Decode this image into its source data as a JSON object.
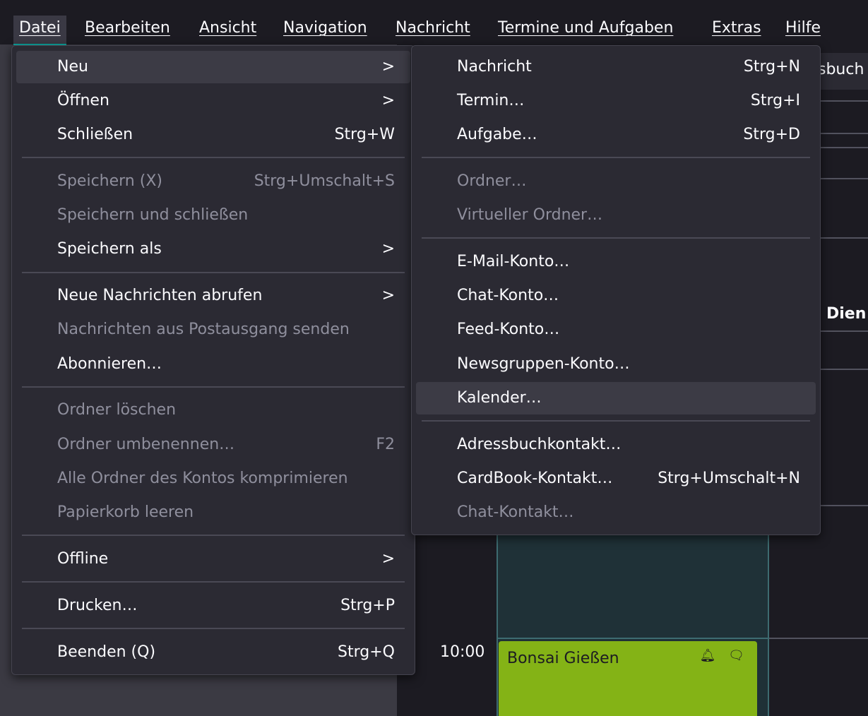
{
  "menubar": {
    "items": [
      {
        "label": "Datei"
      },
      {
        "label": "Bearbeiten"
      },
      {
        "label": "Ansicht"
      },
      {
        "label": "Navigation"
      },
      {
        "label": "Nachricht"
      },
      {
        "label": "Termine und Aufgaben"
      },
      {
        "label": "Extras"
      },
      {
        "label": "Hilfe"
      }
    ]
  },
  "datei_menu": {
    "items": [
      {
        "label": "Neu",
        "accel": "",
        "submenu": true
      },
      {
        "label": "Öffnen",
        "accel": "",
        "submenu": true
      },
      {
        "label": "Schließen",
        "accel": "Strg+W"
      },
      {
        "label": "Speichern (X)",
        "accel": "Strg+Umschalt+S"
      },
      {
        "label": "Speichern und schließen",
        "accel": ""
      },
      {
        "label": "Speichern als",
        "accel": "",
        "submenu": true
      },
      {
        "label": "Neue Nachrichten abrufen",
        "accel": "",
        "submenu": true
      },
      {
        "label": "Nachrichten aus Postausgang senden",
        "accel": ""
      },
      {
        "label": "Abonnieren…",
        "accel": ""
      },
      {
        "label": "Ordner löschen",
        "accel": ""
      },
      {
        "label": "Ordner umbenennen…",
        "accel": "F2"
      },
      {
        "label": "Alle Ordner des Kontos komprimieren",
        "accel": ""
      },
      {
        "label": "Papierkorb leeren",
        "accel": ""
      },
      {
        "label": "Offline",
        "accel": "",
        "submenu": true
      },
      {
        "label": "Drucken…",
        "accel": "Strg+P"
      },
      {
        "label": "Beenden (Q)",
        "accel": "Strg+Q"
      }
    ],
    "arrow": ">"
  },
  "neu_menu": {
    "items": [
      {
        "label": "Nachricht",
        "accel": "Strg+N"
      },
      {
        "label": "Termin…",
        "accel": "Strg+I"
      },
      {
        "label": "Aufgabe…",
        "accel": "Strg+D"
      },
      {
        "label": "Ordner…",
        "accel": ""
      },
      {
        "label": "Virtueller Ordner…",
        "accel": ""
      },
      {
        "label": "E-Mail-Konto…",
        "accel": ""
      },
      {
        "label": "Chat-Konto…",
        "accel": ""
      },
      {
        "label": "Feed-Konto…",
        "accel": ""
      },
      {
        "label": "Newsgruppen-Konto…",
        "accel": ""
      },
      {
        "label": "Kalender…",
        "accel": ""
      },
      {
        "label": "Adressbuchkontakt…",
        "accel": ""
      },
      {
        "label": "CardBook-Kontakt…",
        "accel": "Strg+Umschalt+N"
      },
      {
        "label": "Chat-Kontakt…",
        "accel": ""
      }
    ]
  },
  "background": {
    "tab_fragment": "sbuch",
    "day_fragment": "Dien",
    "time": "10:00",
    "event_title": "Bonsai Gießen",
    "event_icons": "🔔︎ 🗨︎"
  },
  "colors": {
    "menu_bg": "#2b2a33",
    "hover": "#3c3b45",
    "disabled": "#8f8f9d",
    "event": "#84b316",
    "accent": "#0ea5a0"
  }
}
